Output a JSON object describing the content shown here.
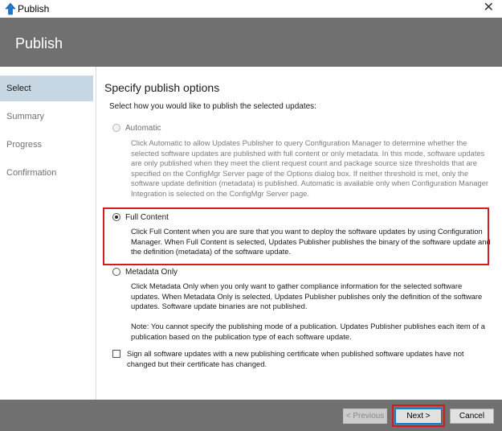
{
  "window": {
    "title": "Publish",
    "close_glyph": "✕",
    "icon": "publish-arrow-icon"
  },
  "banner": {
    "heading": "Publish"
  },
  "sidebar": {
    "items": [
      {
        "label": "Select",
        "active": true
      },
      {
        "label": "Summary",
        "active": false
      },
      {
        "label": "Progress",
        "active": false
      },
      {
        "label": "Confirmation",
        "active": false
      }
    ]
  },
  "main": {
    "title": "Specify publish options",
    "instruction": "Select how you would like to publish the selected updates:",
    "options": {
      "automatic": {
        "label": "Automatic",
        "selected": false,
        "enabled": false,
        "description": "Click Automatic to allow Updates Publisher to query  Configuration Manager to determine whether the selected software updates are published with full content or only metadata. In this mode, software updates are only published when they meet the client request count and package source size thresholds that are specified on the ConfigMgr Server page of the Options dialog box. If neither threshold is met, only the software update definition (metadata) is published. Automatic is available only when Configuration Manager Integration is selected on the ConfigMgr Server page."
      },
      "full_content": {
        "label": "Full Content",
        "selected": true,
        "enabled": true,
        "description": "Click Full Content when you are sure that you want to deploy the software updates by using Configuration Manager. When Full Content is selected, Updates Publisher publishes the binary of the software update and the definition (metadata) of the software update."
      },
      "metadata_only": {
        "label": "Metadata Only",
        "selected": false,
        "enabled": true,
        "description": "Click Metadata Only when you only want to gather compliance information for the selected software updates. When Metadata Only is selected, Updates Publisher publishes only the definition of the software updates. Software update binaries are not published.",
        "note": "Note: You cannot specify the publishing mode of a publication. Updates Publisher publishes each item of a publication based on the publication type of each software update."
      }
    },
    "sign_checkbox": {
      "label": "Sign all software updates with a new publishing certificate when published software updates have not changed but their certificate has changed.",
      "checked": false
    }
  },
  "footer": {
    "previous_label": "< Previous",
    "next_label": "Next >",
    "cancel_label": "Cancel"
  },
  "colors": {
    "banner": "#707070",
    "nav_active": "#c7d6e3",
    "highlight": "#d31b24",
    "icon_blue": "#1e78c8"
  }
}
